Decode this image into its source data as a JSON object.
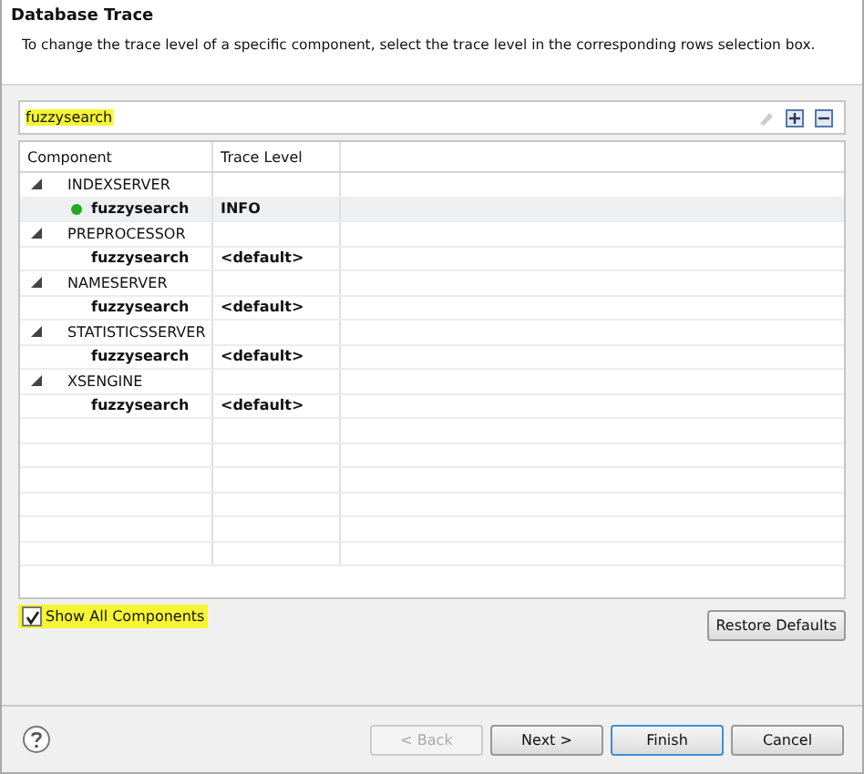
{
  "header": {
    "title": "Database Trace",
    "description": "To change the trace level of a specific component, select the trace level in the corresponding rows selection box."
  },
  "filter": {
    "value": "fuzzysearch"
  },
  "table": {
    "columns": [
      "Component",
      "Trace Level"
    ],
    "groups": [
      {
        "name": "INDEXSERVER",
        "expanded": true,
        "children": [
          {
            "name": "fuzzysearch",
            "trace_level": "INFO",
            "active": true,
            "selected": true
          }
        ]
      },
      {
        "name": "PREPROCESSOR",
        "expanded": true,
        "children": [
          {
            "name": "fuzzysearch",
            "trace_level": "<default>",
            "active": false,
            "selected": false
          }
        ]
      },
      {
        "name": "NAMESERVER",
        "expanded": true,
        "children": [
          {
            "name": "fuzzysearch",
            "trace_level": "<default>",
            "active": false,
            "selected": false
          }
        ]
      },
      {
        "name": "STATISTICSSERVER",
        "expanded": true,
        "children": [
          {
            "name": "fuzzysearch",
            "trace_level": "<default>",
            "active": false,
            "selected": false
          }
        ]
      },
      {
        "name": "XSENGINE",
        "expanded": true,
        "children": [
          {
            "name": "fuzzysearch",
            "trace_level": "<default>",
            "active": false,
            "selected": false
          }
        ]
      }
    ]
  },
  "show_all": {
    "label": "Show All Components",
    "checked": true
  },
  "restore_button": "Restore Defaults",
  "buttons": [
    {
      "label": "< Back",
      "disabled": true,
      "default": false
    },
    {
      "label": "Next >",
      "disabled": false,
      "default": false
    },
    {
      "label": "Finish",
      "disabled": false,
      "default": true
    },
    {
      "label": "Cancel",
      "disabled": false,
      "default": false
    }
  ]
}
